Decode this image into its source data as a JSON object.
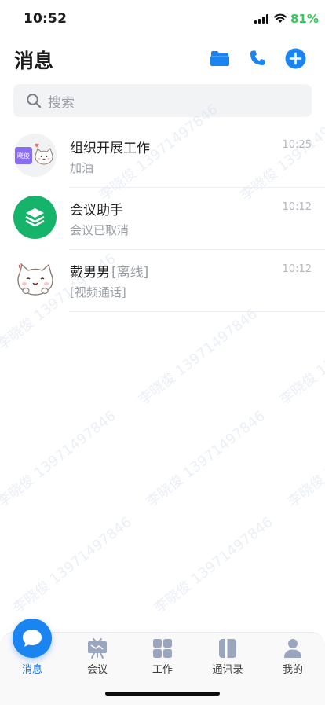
{
  "status_bar": {
    "time": "10:52",
    "battery": "81%"
  },
  "header": {
    "title": "消息",
    "icons": [
      "folder-icon",
      "phone-icon",
      "plus-icon"
    ]
  },
  "search": {
    "placeholder": "搜索"
  },
  "chats": [
    {
      "title": "组织开展工作",
      "tag": "",
      "preview": "加油",
      "time": "10:25",
      "avatar_text": "晓俊"
    },
    {
      "title": "会议助手",
      "tag": "",
      "preview": "会议已取消",
      "time": "10:12"
    },
    {
      "title": "戴男男",
      "tag": "[离线]",
      "preview": "[视频通话]",
      "time": "10:12"
    }
  ],
  "watermark": {
    "name": "李晓俊",
    "number": "13971497846"
  },
  "tabs": [
    {
      "label": "消息",
      "icon": "chat-bubble-icon",
      "active": true
    },
    {
      "label": "会议",
      "icon": "meeting-board-icon"
    },
    {
      "label": "工作",
      "icon": "grid-apps-icon"
    },
    {
      "label": "通讯录",
      "icon": "contacts-book-icon"
    },
    {
      "label": "我的",
      "icon": "person-icon"
    }
  ],
  "colors": {
    "accent": "#1a73e8",
    "battery": "#34c759",
    "assistant_green": "#16b36a",
    "avatar_purple": "#8a6cf0"
  }
}
